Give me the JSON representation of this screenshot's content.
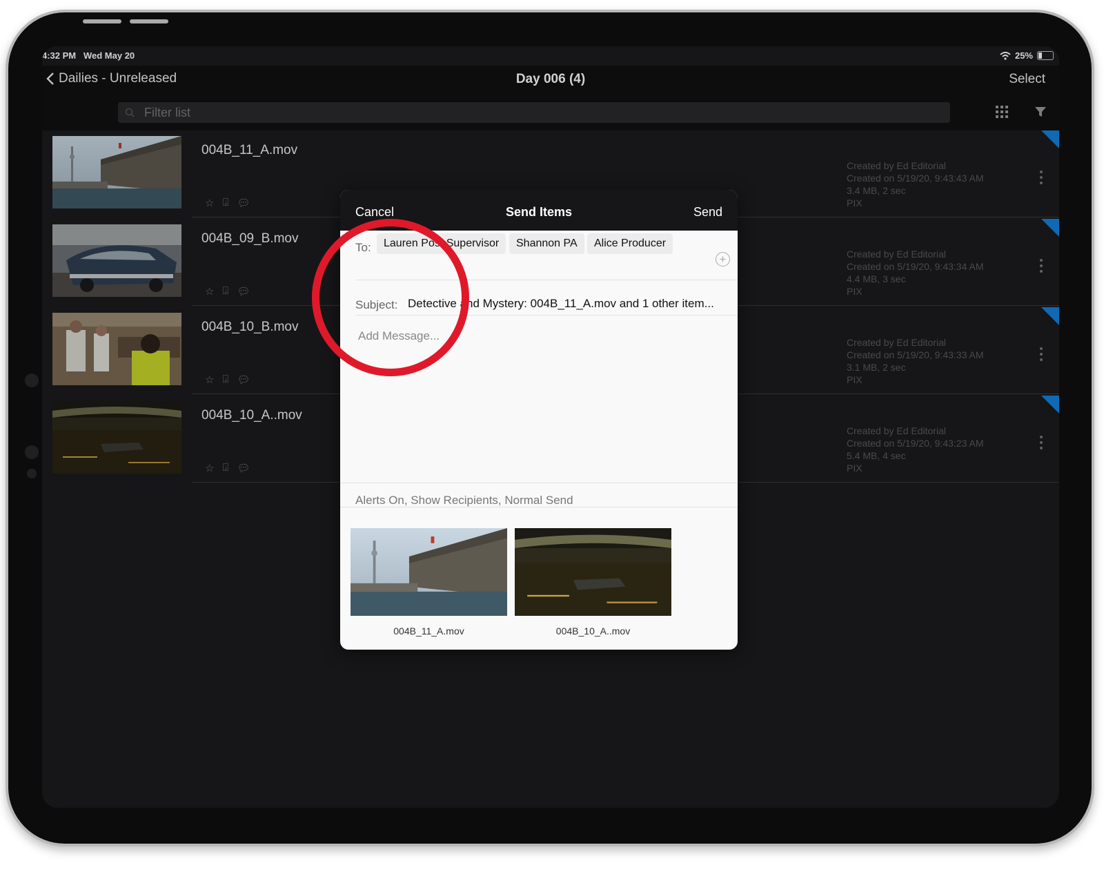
{
  "status": {
    "time": "4:32 PM",
    "date": "Wed May 20",
    "battery": "25%"
  },
  "nav": {
    "back_label": "Dailies - Unreleased",
    "title": "Day 006 (4)",
    "select_label": "Select"
  },
  "filter": {
    "placeholder": "Filter list"
  },
  "rows": [
    {
      "name": "004B_11_A.mov",
      "meta": [
        "Created by Ed Editorial",
        "Created on 5/19/20, 9:43:43 AM",
        "3.4 MB, 2 sec",
        "PIX"
      ]
    },
    {
      "name": "004B_09_B.mov",
      "meta": [
        "Created by Ed Editorial",
        "Created on 5/19/20, 9:43:34 AM",
        "4.4 MB, 3 sec",
        "PIX"
      ]
    },
    {
      "name": "004B_10_B.mov",
      "meta": [
        "Created by Ed Editorial",
        "Created on 5/19/20, 9:43:33 AM",
        "3.1 MB, 2 sec",
        "PIX"
      ]
    },
    {
      "name": "004B_10_A..mov",
      "meta": [
        "Created by Ed Editorial",
        "Created on 5/19/20, 9:43:23 AM",
        "5.4 MB, 4 sec",
        "PIX"
      ]
    }
  ],
  "modal": {
    "cancel_label": "Cancel",
    "title": "Send Items",
    "send_label": "Send",
    "to_label": "To:",
    "recipients": [
      "Lauren Post Supervisor",
      "Shannon PA",
      "Alice Producer"
    ],
    "subject_label": "Subject:",
    "subject_value": "Detective and Mystery: 004B_11_A.mov and 1 other item...",
    "message_placeholder": "Add Message...",
    "options_text": "Alerts On, Show Recipients, Normal Send",
    "attachments": [
      "004B_11_A.mov",
      "004B_10_A..mov"
    ]
  },
  "colors": {
    "accent_corner": "#1481dc",
    "highlight_circle": "#e0192a"
  }
}
